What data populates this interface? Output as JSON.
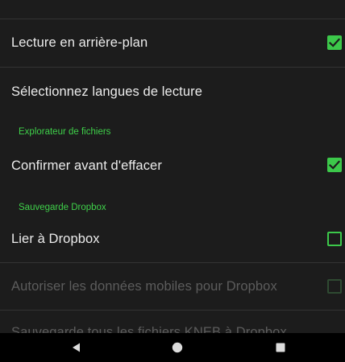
{
  "settings": {
    "rows": [
      {
        "label": "Lecture en arrière-plan",
        "checked": true,
        "enabled": true
      },
      {
        "label": "Sélectionnez langues de lecture",
        "enabled": true
      },
      {
        "label": "Confirmer avant d'effacer",
        "checked": true,
        "enabled": true
      },
      {
        "label": "Lier à Dropbox",
        "checked": false,
        "enabled": true
      },
      {
        "label": "Autoriser les données mobiles pour Dropbox",
        "checked": false,
        "enabled": false
      },
      {
        "label": "Sauvegarde tous les fichiers KNEB à Dropbox",
        "enabled": false
      }
    ],
    "sections": [
      {
        "title": "Explorateur de fichiers"
      },
      {
        "title": "Sauvegarde Dropbox"
      }
    ]
  },
  "navbar": {
    "back_icon": "back-triangle-icon",
    "home_icon": "home-circle-icon",
    "recents_icon": "recents-square-icon"
  },
  "colors": {
    "background": "#1c1c1c",
    "accent": "#3cc84a",
    "text_primary": "#ececec",
    "text_disabled": "#5c5c5c",
    "navbar": "#000000"
  }
}
